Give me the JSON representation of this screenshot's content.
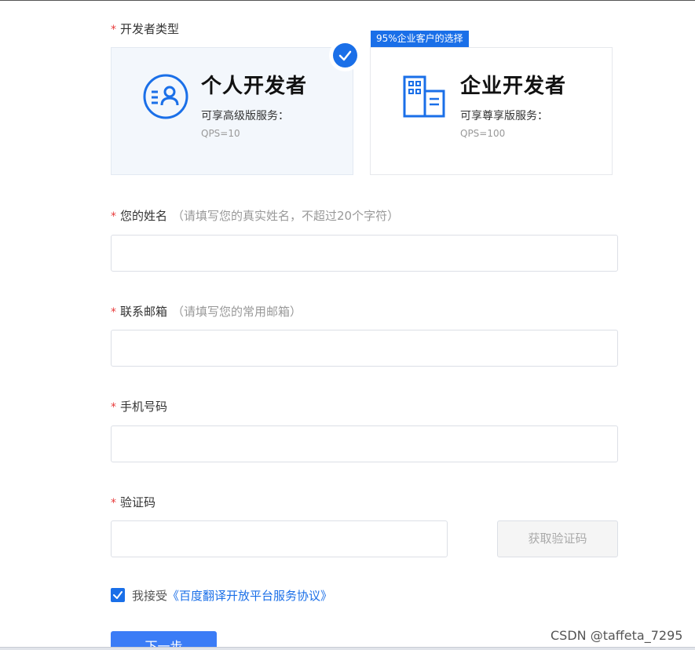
{
  "form": {
    "developer_type": {
      "label": "开发者类型"
    },
    "cards": [
      {
        "title": "个人开发者",
        "desc": "可享高级版服务：",
        "qps": "QPS=10",
        "selected": true,
        "icon": "person-badge-icon"
      },
      {
        "title": "企业开发者",
        "desc": "可享尊享版服务：",
        "qps": "QPS=100",
        "selected": false,
        "icon": "building-icon",
        "tag": "95%企业客户的选择"
      }
    ],
    "name": {
      "label": "您的姓名",
      "hint": "（请填写您的真实姓名，不超过20个字符）",
      "value": ""
    },
    "email": {
      "label": "联系邮箱",
      "hint": "（请填写您的常用邮箱）",
      "value": ""
    },
    "phone": {
      "label": "手机号码",
      "value": ""
    },
    "code": {
      "label": "验证码",
      "value": "",
      "button": "获取验证码"
    },
    "agreement": {
      "prefix": "我接受",
      "link": "《百度翻译开放平台服务协议》",
      "checked": true
    },
    "submit": {
      "label": "下一步"
    }
  },
  "watermark": "CSDN @taffeta_7295",
  "colors": {
    "accent": "#1a6fe8",
    "required": "#e83b3b",
    "selected_card_bg": "#f3f7fc"
  }
}
